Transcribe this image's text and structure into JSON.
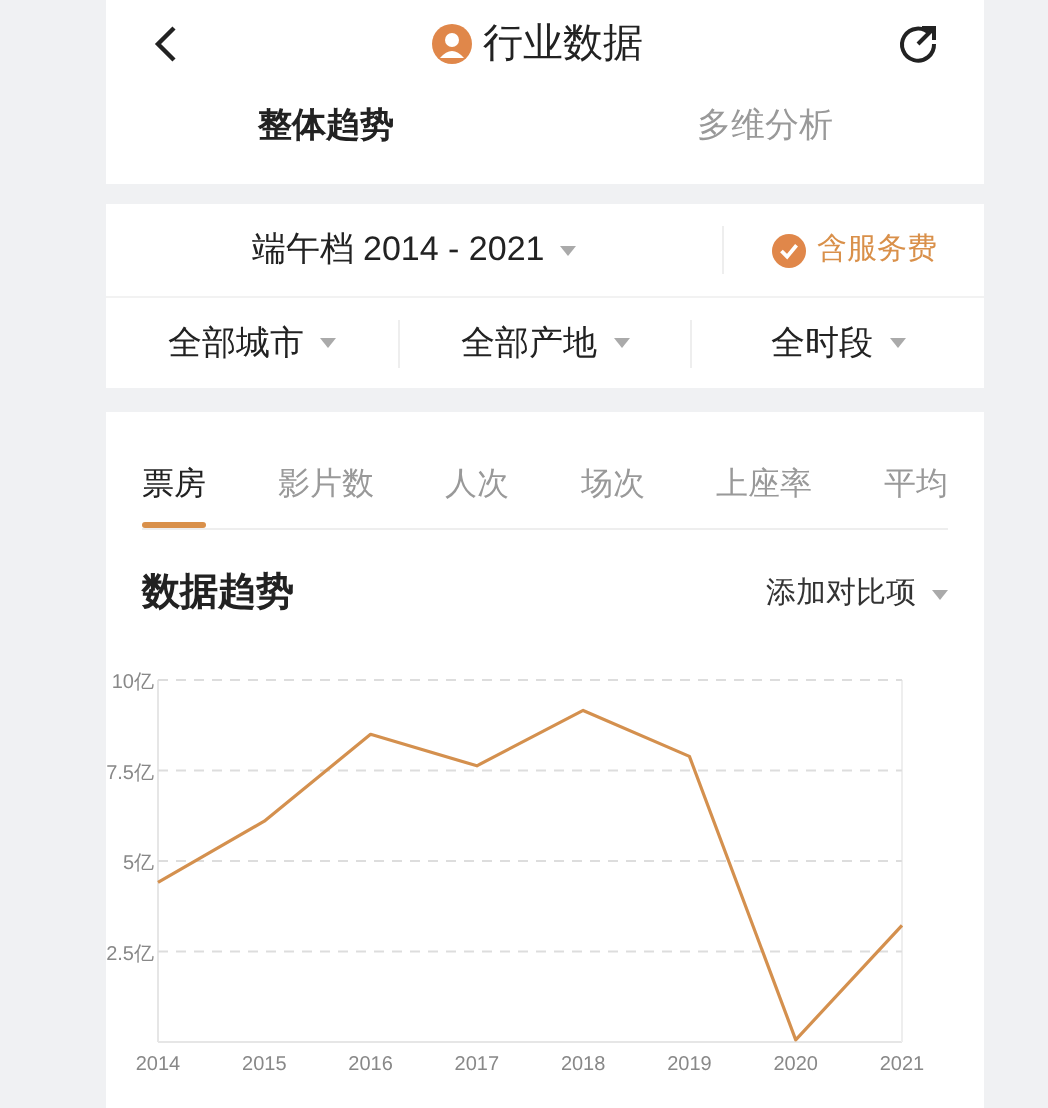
{
  "header": {
    "title": "行业数据"
  },
  "tabs": [
    {
      "label": "整体趋势",
      "selected": true
    },
    {
      "label": "多维分析",
      "selected": false
    }
  ],
  "filters": {
    "period": "端午档 2014 - 2021",
    "service_fee": {
      "label": "含服务费",
      "checked": true
    },
    "dropdowns": [
      "全部城市",
      "全部产地",
      "全时段"
    ]
  },
  "metric_tabs": [
    {
      "label": "票房",
      "selected": true
    },
    {
      "label": "影片数",
      "selected": false
    },
    {
      "label": "人次",
      "selected": false
    },
    {
      "label": "场次",
      "selected": false
    },
    {
      "label": "上座率",
      "selected": false
    },
    {
      "label": "平均",
      "selected": false
    }
  ],
  "trend": {
    "title": "数据趋势",
    "compare": "添加对比项",
    "chart_data": {
      "type": "line",
      "categories": [
        "2014",
        "2015",
        "2016",
        "2017",
        "2018",
        "2019",
        "2020",
        "2021"
      ],
      "series": [
        {
          "color": "#d4904e",
          "values": [
            4.41,
            6.1,
            8.5,
            7.63,
            9.16,
            7.89,
            0.06,
            3.22
          ]
        }
      ],
      "ylim": [
        0,
        10
      ],
      "grid": true,
      "yticks": [
        {
          "value": 2.5,
          "label": "2.5亿"
        },
        {
          "value": 5,
          "label": "5亿"
        },
        {
          "value": 7.5,
          "label": "7.5亿"
        },
        {
          "value": 10,
          "label": "10亿"
        }
      ]
    }
  }
}
